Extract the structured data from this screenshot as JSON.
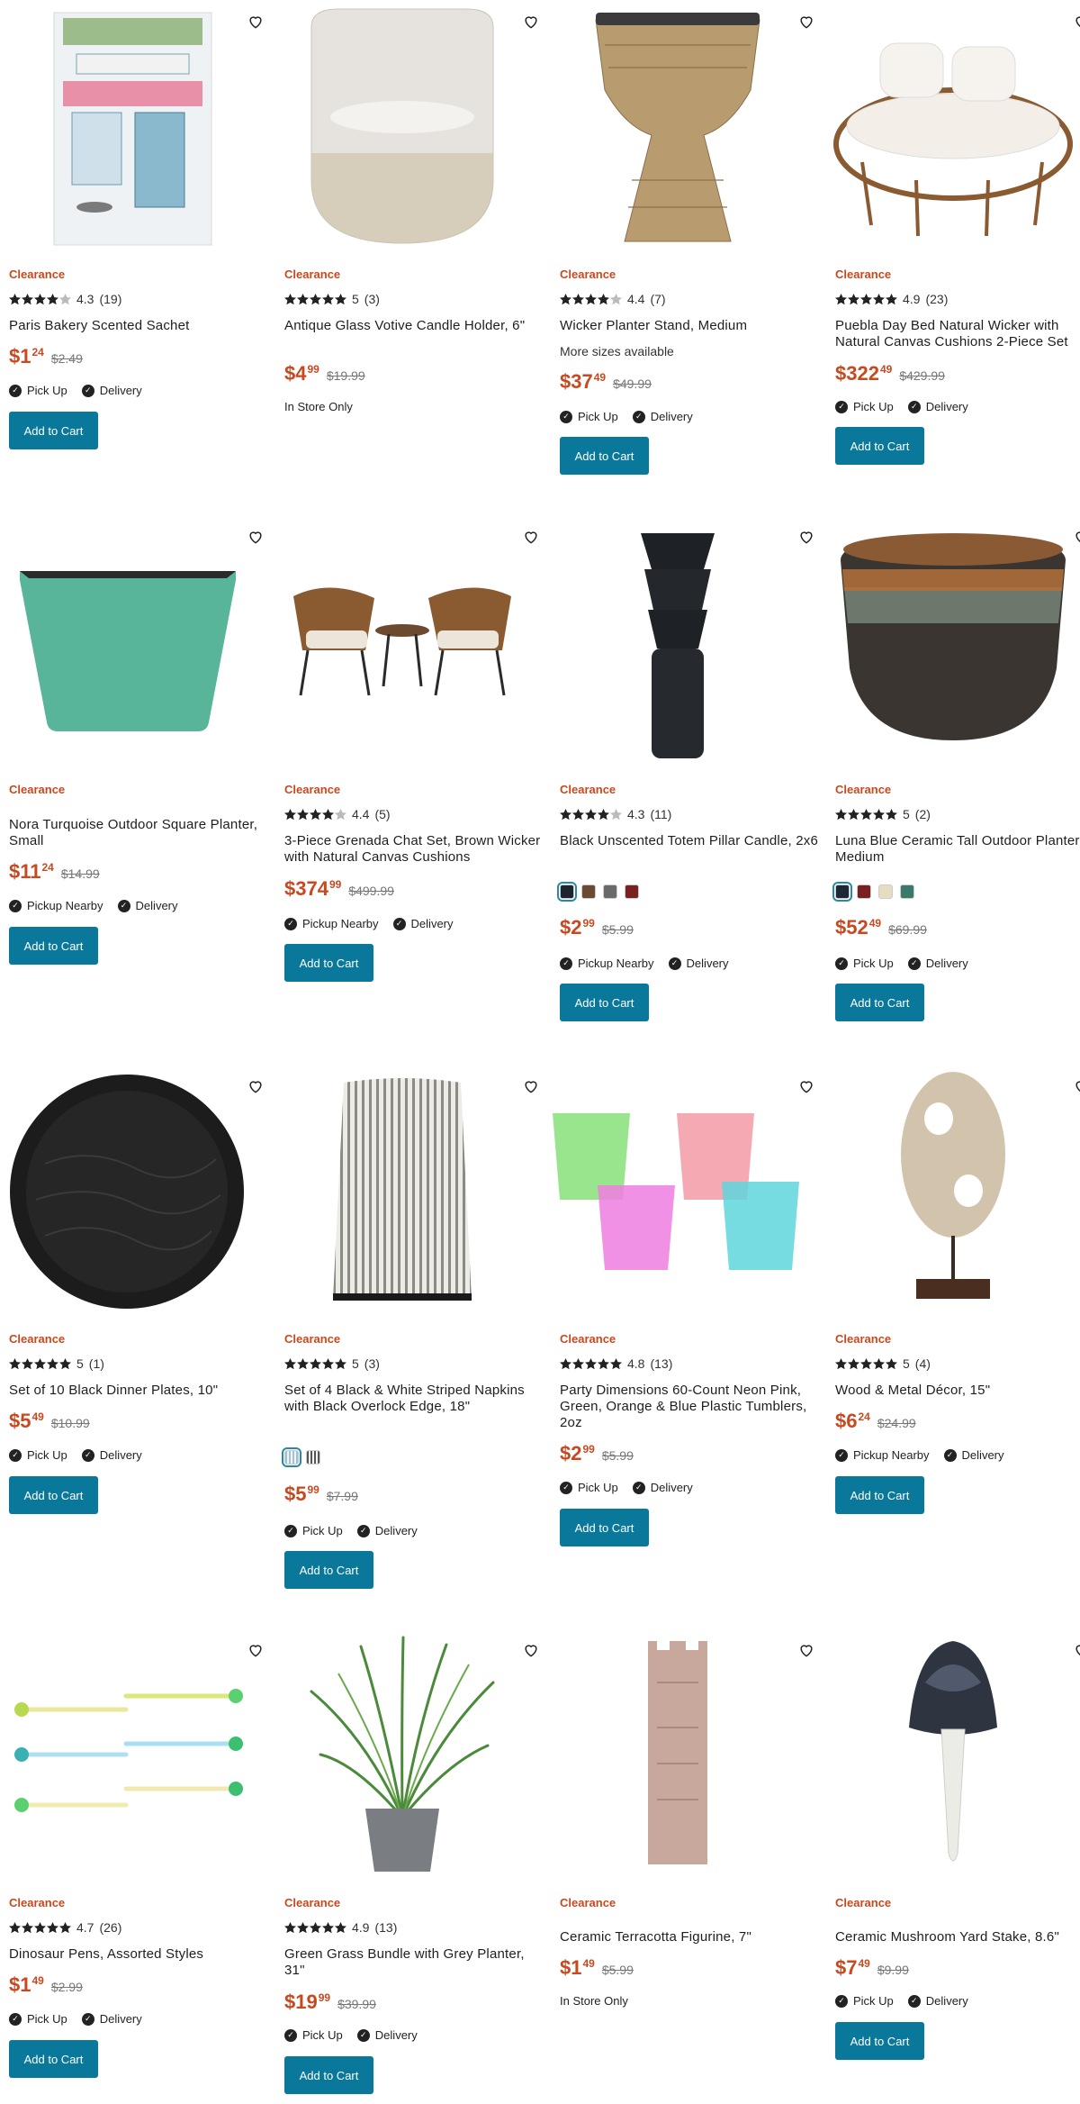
{
  "labels": {
    "clearance": "Clearance",
    "add_to_cart": "Add to Cart",
    "pick_up": "Pick Up",
    "pickup_nearby": "Pickup Nearby",
    "delivery": "Delivery",
    "in_store_only": "In Store Only",
    "more_sizes": "More sizes available"
  },
  "colors": {
    "accent": "#c8491f",
    "button": "#0a789b"
  },
  "products": [
    {
      "title": "Paris Bakery Scented Sachet",
      "rating": "4.3",
      "reviews": "(19)",
      "price_dollars": "$1",
      "price_cents": "24",
      "was": "$2.49",
      "pickup": "Pick Up",
      "delivery": "Delivery"
    },
    {
      "title": "Antique Glass Votive Candle Holder, 6\"",
      "rating": "5",
      "reviews": "(3)",
      "price_dollars": "$4",
      "price_cents": "99",
      "was": "$19.99",
      "in_store": "In Store Only"
    },
    {
      "title": "Wicker Planter Stand, Medium",
      "rating": "4.4",
      "reviews": "(7)",
      "more": "More sizes available",
      "price_dollars": "$37",
      "price_cents": "49",
      "was": "$49.99",
      "pickup": "Pick Up",
      "delivery": "Delivery"
    },
    {
      "title": "Puebla Day Bed Natural Wicker with Natural Canvas Cushions 2-Piece Set",
      "rating": "4.9",
      "reviews": "(23)",
      "price_dollars": "$322",
      "price_cents": "49",
      "was": "$429.99",
      "pickup": "Pick Up",
      "delivery": "Delivery"
    },
    {
      "title": "Nora Turquoise Outdoor Square Planter, Small",
      "price_dollars": "$11",
      "price_cents": "24",
      "was": "$14.99",
      "pickup": "Pickup Nearby",
      "delivery": "Delivery"
    },
    {
      "title": "3-Piece Grenada Chat Set, Brown Wicker with Natural Canvas Cushions",
      "rating": "4.4",
      "reviews": "(5)",
      "price_dollars": "$374",
      "price_cents": "99",
      "was": "$499.99",
      "pickup": "Pickup Nearby",
      "delivery": "Delivery"
    },
    {
      "title": "Black Unscented Totem Pillar Candle, 2x6",
      "rating": "4.3",
      "reviews": "(11)",
      "swatches": [
        "#1e2430",
        "#6b4a34",
        "#6a6a6a",
        "#7a2020"
      ],
      "price_dollars": "$2",
      "price_cents": "99",
      "was": "$5.99",
      "pickup": "Pickup Nearby",
      "delivery": "Delivery"
    },
    {
      "title": "Luna Blue Ceramic Tall Outdoor Planter, Medium",
      "rating": "5",
      "reviews": "(2)",
      "swatches": [
        "#1d2836",
        "#7a1f1f",
        "#e6dcc0",
        "#3a7a6a"
      ],
      "price_dollars": "$52",
      "price_cents": "49",
      "was": "$69.99",
      "pickup": "Pick Up",
      "delivery": "Delivery"
    },
    {
      "title": "Set of 10 Black Dinner Plates, 10\"",
      "rating": "5",
      "reviews": "(1)",
      "price_dollars": "$5",
      "price_cents": "49",
      "was": "$10.99",
      "pickup": "Pick Up",
      "delivery": "Delivery"
    },
    {
      "title": "Set of 4 Black & White Striped Napkins with Black Overlock Edge, 18\"",
      "rating": "5",
      "reviews": "(3)",
      "swatches": [
        "stripe-blue",
        "stripe-gray"
      ],
      "price_dollars": "$5",
      "price_cents": "99",
      "was": "$7.99",
      "pickup": "Pick Up",
      "delivery": "Delivery"
    },
    {
      "title": "Party Dimensions 60-Count Neon Pink, Green, Orange & Blue Plastic Tumblers, 2oz",
      "rating": "4.8",
      "reviews": "(13)",
      "price_dollars": "$2",
      "price_cents": "99",
      "was": "$5.99",
      "pickup": "Pick Up",
      "delivery": "Delivery"
    },
    {
      "title": "Wood & Metal Décor, 15\"",
      "rating": "5",
      "reviews": "(4)",
      "price_dollars": "$6",
      "price_cents": "24",
      "was": "$24.99",
      "pickup": "Pickup Nearby",
      "delivery": "Delivery"
    },
    {
      "title": "Dinosaur Pens, Assorted Styles",
      "rating": "4.7",
      "reviews": "(26)",
      "price_dollars": "$1",
      "price_cents": "49",
      "was": "$2.99",
      "pickup": "Pick Up",
      "delivery": "Delivery"
    },
    {
      "title": "Green Grass Bundle with Grey Planter, 31\"",
      "rating": "4.9",
      "reviews": "(13)",
      "price_dollars": "$19",
      "price_cents": "99",
      "was": "$39.99",
      "pickup": "Pick Up",
      "delivery": "Delivery"
    },
    {
      "title": "Ceramic Terracotta Figurine, 7\"",
      "price_dollars": "$1",
      "price_cents": "49",
      "was": "$5.99",
      "in_store": "In Store Only"
    },
    {
      "title": "Ceramic Mushroom Yard Stake, 8.6\"",
      "price_dollars": "$7",
      "price_cents": "49",
      "was": "$9.99",
      "pickup": "Pick Up",
      "delivery": "Delivery"
    }
  ]
}
